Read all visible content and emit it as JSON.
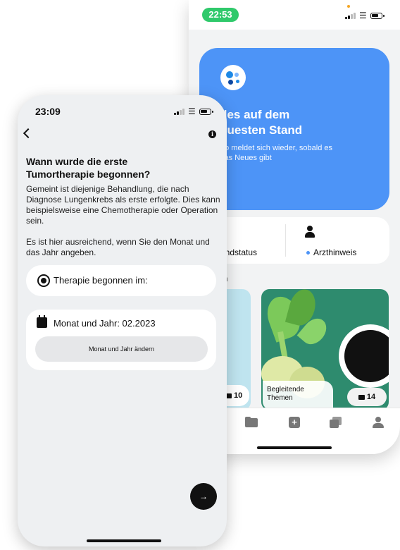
{
  "back_phone": {
    "status": {
      "time": "22:53"
    },
    "hero": {
      "title": "lles auf dem\neuesten Stand",
      "subtitle": "go meldet sich wieder, sobald es\nvas Neues gibt"
    },
    "info": {
      "left_label": "undstatus",
      "right_label": "Arzthinweis"
    },
    "section_title": "n",
    "tiles": [
      {
        "count": "10"
      },
      {
        "caption": "Begleitende\nThemen",
        "count": "14"
      }
    ],
    "tabbar": [
      "folder-icon",
      "plus-icon",
      "cards-icon",
      "person-icon"
    ]
  },
  "front_phone": {
    "status": {
      "time": "23:09"
    },
    "question_title": "Wann wurde die erste\nTumortherapie begonnen?",
    "description": "Gemeint ist diejenige Behandlung, die nach Diagnose Lungenkrebs als erste erfolgte. Dies kann beispielsweise eine Chemotherapie oder Operation sein.",
    "description2": "Es ist hier ausreichend, wenn Sie den Monat und das Jahr angeben.",
    "radio_label": "Therapie begonnen im:",
    "date_label": "Monat und Jahr: 02.2023",
    "change_button": "Monat und Jahr ändern",
    "next_button": "→"
  },
  "colors": {
    "hero_blue": "#4d94f7",
    "time_pill_green": "#2fc96b",
    "background": "#eef0f2"
  }
}
